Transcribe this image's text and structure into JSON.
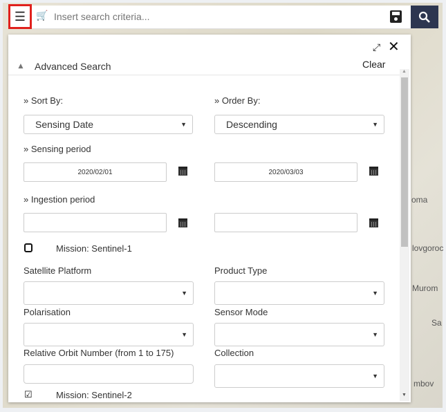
{
  "map": {
    "labels": [
      "oma",
      "lovgoroc",
      "Murom",
      "Sa",
      "mbov"
    ]
  },
  "topbar": {
    "search_placeholder": "Insert search criteria..."
  },
  "panel": {
    "title": "Advanced Search",
    "clear_label": "Clear",
    "sort_by": {
      "label": "» Sort By:",
      "value": "Sensing Date"
    },
    "order_by": {
      "label": "» Order By:",
      "value": "Descending"
    },
    "sensing_period": {
      "label": "» Sensing period",
      "from": "2020/02/01",
      "to": "2020/03/03"
    },
    "ingestion_period": {
      "label": "» Ingestion period",
      "from": "",
      "to": ""
    },
    "mission1": {
      "label": "Mission: Sentinel-1",
      "checked": false
    },
    "satellite_platform": {
      "label": "Satellite Platform",
      "value": ""
    },
    "product_type": {
      "label": "Product Type",
      "value": ""
    },
    "polarisation": {
      "label": "Polarisation",
      "value": ""
    },
    "sensor_mode": {
      "label": "Sensor Mode",
      "value": ""
    },
    "relative_orbit": {
      "label": "Relative Orbit Number (from 1 to 175)",
      "value": ""
    },
    "collection": {
      "label": "Collection",
      "value": ""
    },
    "mission2": {
      "label": "Mission: Sentinel-2",
      "checked": true
    }
  }
}
